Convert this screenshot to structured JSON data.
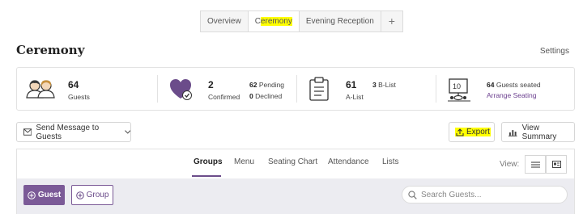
{
  "tabs": [
    {
      "label": "Overview"
    },
    {
      "label_prefix": "C",
      "label_highlight": "eremony"
    },
    {
      "label": "Evening Reception"
    },
    {
      "label": "+"
    }
  ],
  "page": {
    "title": "Ceremony",
    "settings": "Settings"
  },
  "stats": {
    "guests": {
      "count": "64",
      "label": "Guests"
    },
    "rsvp": {
      "count": "2",
      "label": "Confirmed",
      "pending_count": "62",
      "pending_label": "Pending",
      "declined_count": "0",
      "declined_label": "Declined"
    },
    "lists": {
      "a_count": "61",
      "a_label": "A-List",
      "b_count": "3",
      "b_label": "B-List"
    },
    "seating": {
      "count": "64",
      "label": "Guests seated",
      "link": "Arrange Seating"
    }
  },
  "actions": {
    "send_message": "Send Message to Guests",
    "export": "Export",
    "view_summary": "View Summary"
  },
  "subtabs": [
    "Groups",
    "Menu",
    "Seating Chart",
    "Attendance",
    "Lists"
  ],
  "view": {
    "label": "View:"
  },
  "toolbar": {
    "guest_button": "Guest",
    "group_button": "Group",
    "search_placeholder": "Search Guests..."
  },
  "colors": {
    "accent": "#7b5a97",
    "highlight": "#ffff00"
  }
}
